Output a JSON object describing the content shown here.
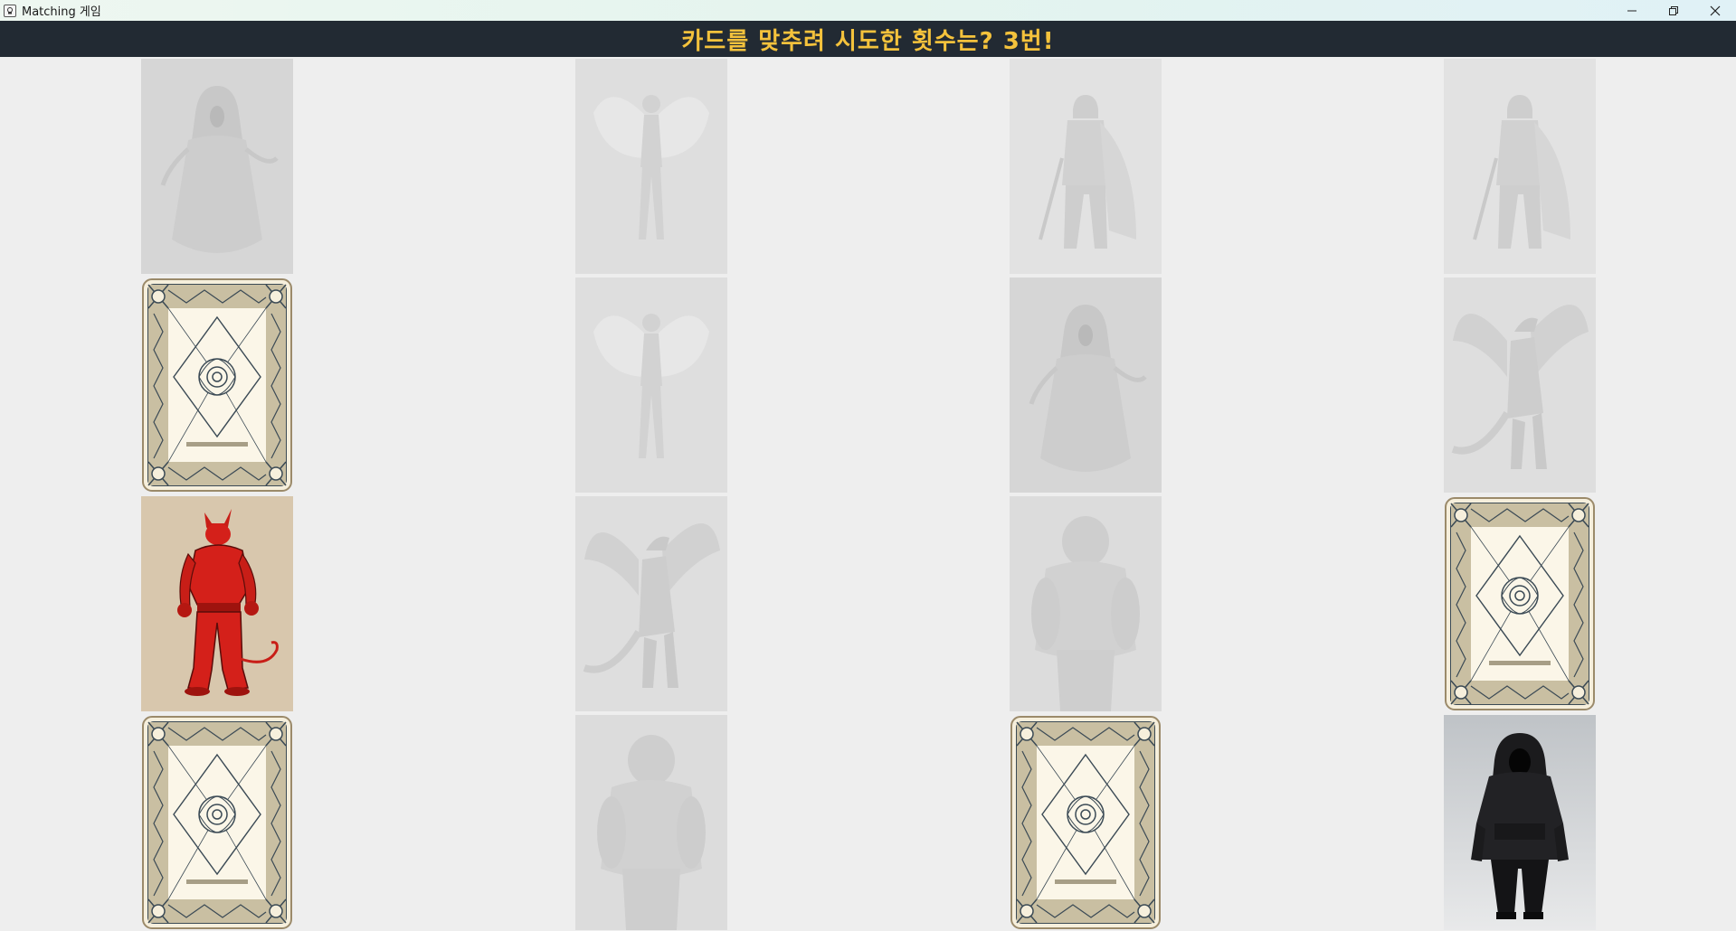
{
  "window": {
    "title": "Matching 게임",
    "controls": [
      "minimize-icon",
      "maximize-icon",
      "close-icon"
    ]
  },
  "header": {
    "text": "카드를 맞추려 시도한 횟수는? 3번!"
  },
  "colors": {
    "header_bg": "#222a33",
    "header_text": "#f4c23c",
    "board_bg": "#eeeeee",
    "card_back_bg": "#f6efdc",
    "demon_red": "#d4201a"
  },
  "board": {
    "rows": 4,
    "cols": 4,
    "cards": [
      {
        "state": "matched",
        "image": "wraith"
      },
      {
        "state": "matched",
        "image": "fairy"
      },
      {
        "state": "matched",
        "image": "knight"
      },
      {
        "state": "matched",
        "image": "knight"
      },
      {
        "state": "face-down",
        "image": "card-back"
      },
      {
        "state": "matched",
        "image": "fairy"
      },
      {
        "state": "matched",
        "image": "wraith"
      },
      {
        "state": "matched",
        "image": "dragon"
      },
      {
        "state": "face-up",
        "image": "red-demon"
      },
      {
        "state": "matched",
        "image": "dragon"
      },
      {
        "state": "matched",
        "image": "troll"
      },
      {
        "state": "face-down",
        "image": "card-back"
      },
      {
        "state": "face-down",
        "image": "card-back"
      },
      {
        "state": "matched",
        "image": "troll"
      },
      {
        "state": "face-down",
        "image": "card-back"
      },
      {
        "state": "face-up",
        "image": "hooded-figure"
      }
    ]
  }
}
